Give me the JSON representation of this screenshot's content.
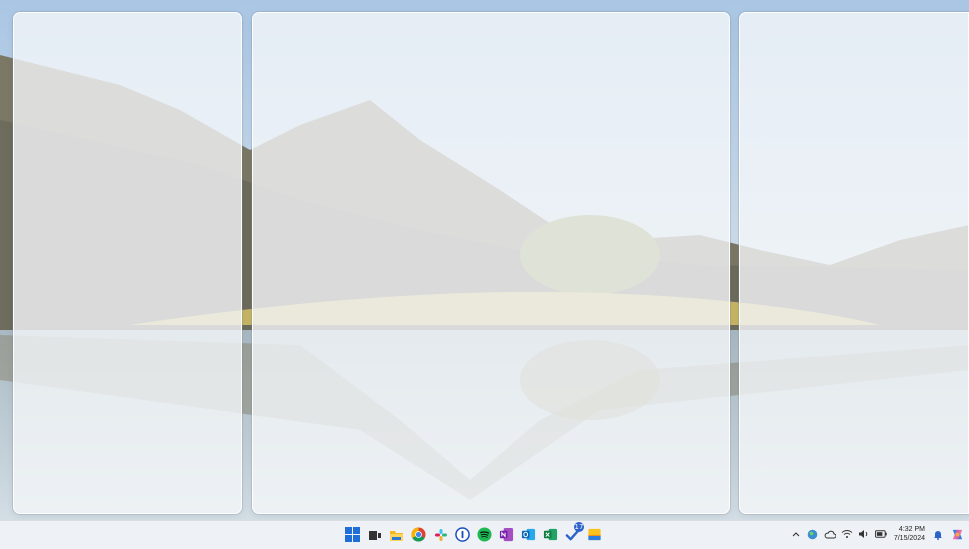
{
  "taskbar": {
    "pinned_apps": [
      {
        "name": "start-button"
      },
      {
        "name": "task-view-button"
      },
      {
        "name": "file-explorer-button"
      },
      {
        "name": "chrome-button"
      },
      {
        "name": "slack-button"
      },
      {
        "name": "password-manager-button"
      },
      {
        "name": "spotify-button"
      },
      {
        "name": "onenote-button"
      },
      {
        "name": "outlook-button"
      },
      {
        "name": "excel-button"
      },
      {
        "name": "todo-button",
        "badge": "17"
      },
      {
        "name": "sticky-notes-button"
      }
    ],
    "tray": {
      "clock_time": "4:32 PM",
      "clock_date": "7/15/2024"
    }
  },
  "colors": {
    "taskbar_bg": "#eef1f5",
    "zone_bg": "#f4f6f9",
    "accent": "#2b63c9"
  }
}
